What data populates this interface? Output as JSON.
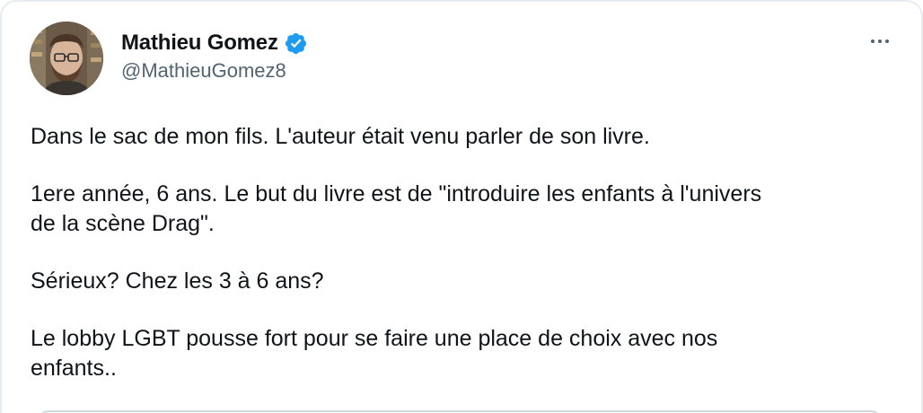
{
  "tweet": {
    "author": {
      "display_name": "Mathieu Gomez",
      "handle": "@MathieuGomez8",
      "verified": true,
      "verified_color": "#1d9bf0"
    },
    "more_icon": "more-horizontal-icon",
    "paragraphs": [
      "Dans le sac de mon fils. L'auteur était venu parler de son livre.",
      "1ere année, 6 ans. Le but du livre est de \"introduire les enfants à l'univers\nde la scène Drag\".",
      "Sérieux? Chez les 3 à 6 ans?",
      "Le lobby LGBT pousse fort pour se faire une place de choix avec nos\nenfants.."
    ]
  }
}
